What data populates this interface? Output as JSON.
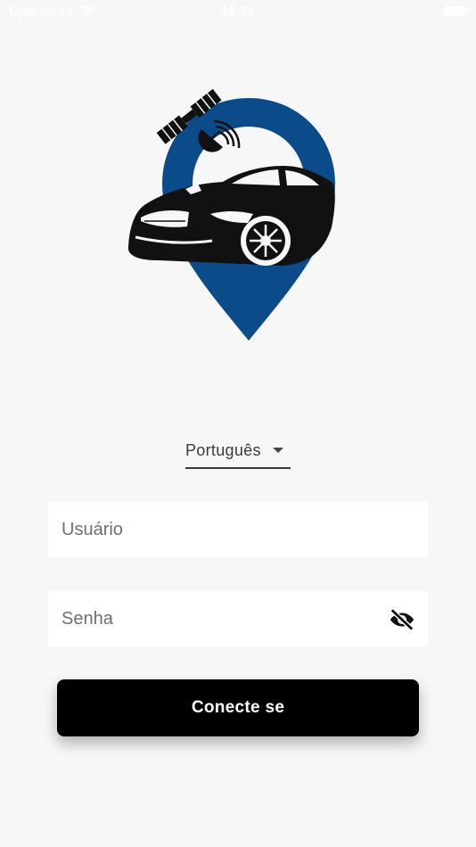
{
  "status_bar": {
    "carrier": "Operadora",
    "time": "18:37"
  },
  "icons": {
    "wifi": "wifi-icon",
    "battery": "battery-icon",
    "logo": "car-location-pin-satellite-logo",
    "dropdown": "dropdown-arrow-icon",
    "password_toggle": "eye-off-icon"
  },
  "colors": {
    "pin": "#0b4b8a",
    "button": "#000000",
    "background": "#f7f7f7"
  },
  "language_selector": {
    "selected": "Português"
  },
  "username_field": {
    "placeholder": "Usuário",
    "value": ""
  },
  "password_field": {
    "placeholder": "Senha",
    "value": ""
  },
  "login_button": {
    "label": "Conecte se"
  }
}
